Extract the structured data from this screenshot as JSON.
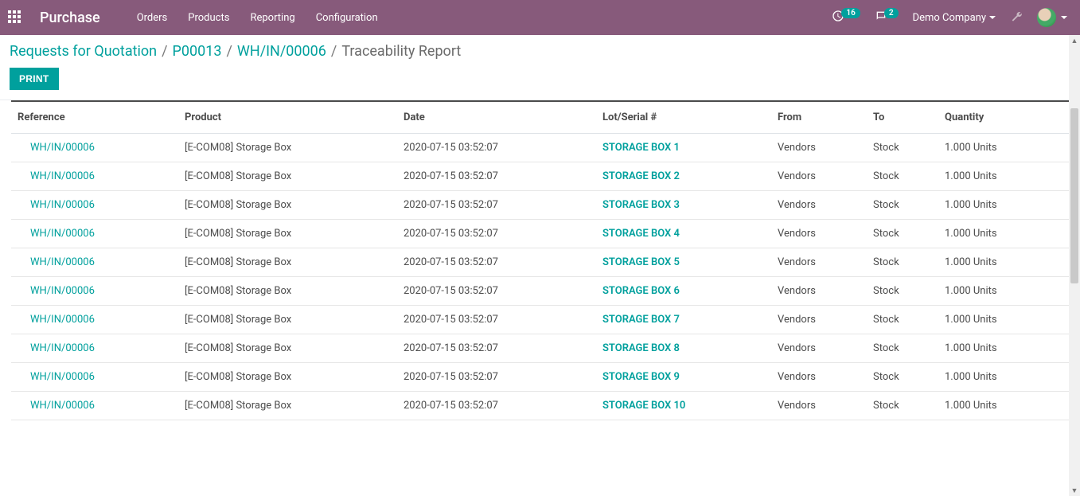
{
  "navbar": {
    "app_title": "Purchase",
    "menu": [
      "Orders",
      "Products",
      "Reporting",
      "Configuration"
    ],
    "activity_count": "16",
    "message_count": "2",
    "company": "Demo Company"
  },
  "breadcrumb": {
    "items": [
      {
        "label": "Requests for Quotation",
        "link": true
      },
      {
        "label": "P00013",
        "link": true
      },
      {
        "label": "WH/IN/00006",
        "link": true
      },
      {
        "label": "Traceability Report",
        "link": false
      }
    ]
  },
  "buttons": {
    "print": "PRINT"
  },
  "table": {
    "headers": {
      "reference": "Reference",
      "product": "Product",
      "date": "Date",
      "lot": "Lot/Serial #",
      "from": "From",
      "to": "To",
      "quantity": "Quantity"
    },
    "rows": [
      {
        "reference": "WH/IN/00006",
        "product": "[E-COM08] Storage Box",
        "date": "2020-07-15 03:52:07",
        "lot": "STORAGE BOX 1",
        "from": "Vendors",
        "to": "Stock",
        "quantity": "1.000 Units"
      },
      {
        "reference": "WH/IN/00006",
        "product": "[E-COM08] Storage Box",
        "date": "2020-07-15 03:52:07",
        "lot": "STORAGE BOX 2",
        "from": "Vendors",
        "to": "Stock",
        "quantity": "1.000 Units"
      },
      {
        "reference": "WH/IN/00006",
        "product": "[E-COM08] Storage Box",
        "date": "2020-07-15 03:52:07",
        "lot": "STORAGE BOX 3",
        "from": "Vendors",
        "to": "Stock",
        "quantity": "1.000 Units"
      },
      {
        "reference": "WH/IN/00006",
        "product": "[E-COM08] Storage Box",
        "date": "2020-07-15 03:52:07",
        "lot": "STORAGE BOX 4",
        "from": "Vendors",
        "to": "Stock",
        "quantity": "1.000 Units"
      },
      {
        "reference": "WH/IN/00006",
        "product": "[E-COM08] Storage Box",
        "date": "2020-07-15 03:52:07",
        "lot": "STORAGE BOX 5",
        "from": "Vendors",
        "to": "Stock",
        "quantity": "1.000 Units"
      },
      {
        "reference": "WH/IN/00006",
        "product": "[E-COM08] Storage Box",
        "date": "2020-07-15 03:52:07",
        "lot": "STORAGE BOX 6",
        "from": "Vendors",
        "to": "Stock",
        "quantity": "1.000 Units"
      },
      {
        "reference": "WH/IN/00006",
        "product": "[E-COM08] Storage Box",
        "date": "2020-07-15 03:52:07",
        "lot": "STORAGE BOX 7",
        "from": "Vendors",
        "to": "Stock",
        "quantity": "1.000 Units"
      },
      {
        "reference": "WH/IN/00006",
        "product": "[E-COM08] Storage Box",
        "date": "2020-07-15 03:52:07",
        "lot": "STORAGE BOX 8",
        "from": "Vendors",
        "to": "Stock",
        "quantity": "1.000 Units"
      },
      {
        "reference": "WH/IN/00006",
        "product": "[E-COM08] Storage Box",
        "date": "2020-07-15 03:52:07",
        "lot": "STORAGE BOX 9",
        "from": "Vendors",
        "to": "Stock",
        "quantity": "1.000 Units"
      },
      {
        "reference": "WH/IN/00006",
        "product": "[E-COM08] Storage Box",
        "date": "2020-07-15 03:52:07",
        "lot": "STORAGE BOX 10",
        "from": "Vendors",
        "to": "Stock",
        "quantity": "1.000 Units"
      }
    ]
  }
}
